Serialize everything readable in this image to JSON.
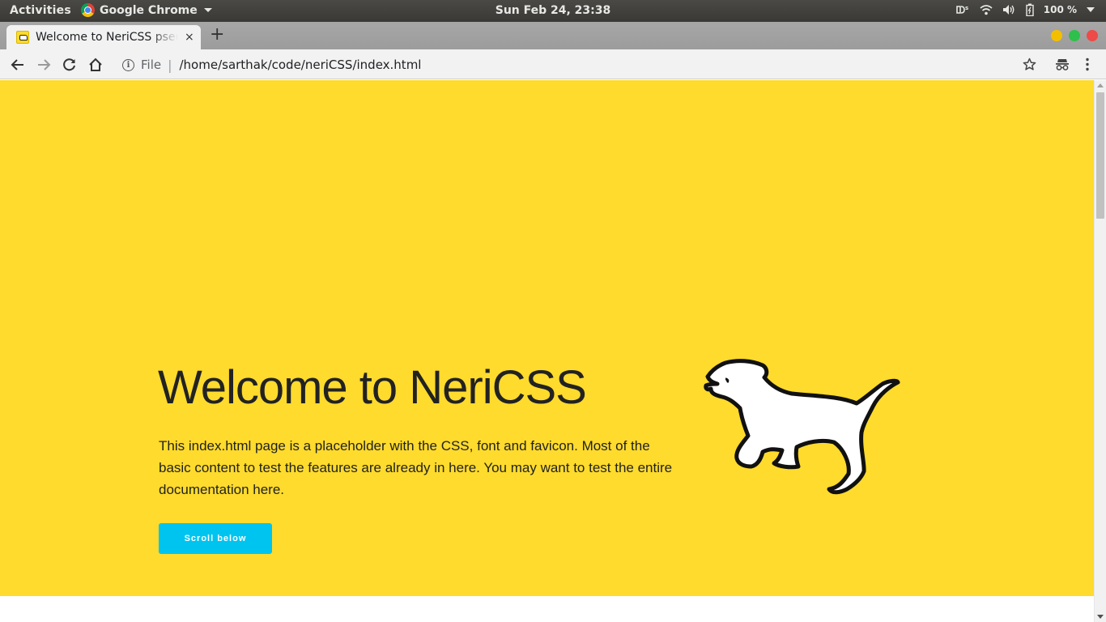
{
  "system_bar": {
    "activities": "Activities",
    "app_name": "Google Chrome",
    "clock": "Sun Feb 24, 23:38",
    "battery_percent": "100 %"
  },
  "browser": {
    "tab_title": "Welcome to NeriCSS pseudo",
    "new_tab": "+",
    "tab_close": "×",
    "address_scheme": "File",
    "address_url": "/home/sarthak/code/neriCSS/index.html",
    "window_controls_colors": [
      "#f4bf00",
      "#2fbf4c",
      "#ee4a47"
    ]
  },
  "page": {
    "hero": {
      "heading": "Welcome to NeriCSS",
      "description": "This index.html page is a placeholder with the CSS, font and favicon. Most of the basic content to test the features are already in here. You may want to test the entire documentation here.",
      "button_label": "Scroll below",
      "background_color": "#fedb2c",
      "button_color": "#00c4f0"
    },
    "illustration_icon": "running-dog-icon"
  }
}
